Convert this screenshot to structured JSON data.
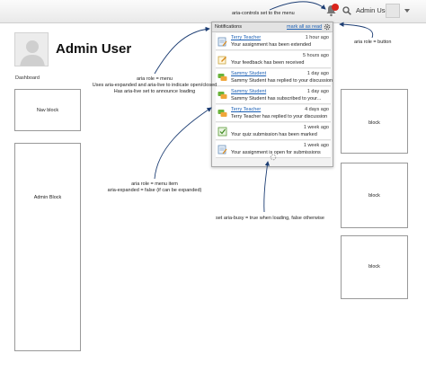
{
  "topbar": {
    "username": "Admin User"
  },
  "page": {
    "title": "Admin User",
    "breadcrumb": "Dashboard"
  },
  "blocks": {
    "nav": "Nav block",
    "admin": "Admin Block",
    "right1": "block",
    "right2": "block",
    "right3": "block"
  },
  "notifications": {
    "header": "Notifications",
    "mark_all": "mark all as read",
    "items": [
      {
        "name": "Terry Teacher",
        "time": "1 hour ago",
        "text": "Your assignment has been extended",
        "icon": "assignment-icon"
      },
      {
        "name": "",
        "time": "5 hours ago",
        "text": "Your feedback has been received",
        "icon": "feedback-icon"
      },
      {
        "name": "Sammy Student",
        "time": "1 day ago",
        "text": "Sammy Student has replied to your discussion",
        "icon": "forum-icon"
      },
      {
        "name": "Sammy Student",
        "time": "1 day ago",
        "text": "Sammy Student has subscribed to your...",
        "icon": "forum-icon"
      },
      {
        "name": "Terry Teacher",
        "time": "4 days ago",
        "text": "Terry Teacher has replied to your discussion",
        "icon": "forum-icon"
      },
      {
        "name": "",
        "time": "1 week ago",
        "text": "Your quiz submission has been marked",
        "icon": "quiz-icon"
      },
      {
        "name": "",
        "time": "1 week ago",
        "text": "Your assignment is open for submissions",
        "icon": "assignment-icon"
      }
    ]
  },
  "annotations": {
    "controls": "aria-controls set to the menu",
    "button": "aria role = button",
    "menu_1": "aria role = menu",
    "menu_2": "Uses aria-expanded and aria-live to indicate open/closed",
    "menu_3": "Has aria-live set to announce loading",
    "item_1": "aria role = menu item",
    "item_2": "aria-expanded = false (if can be expanded)",
    "busy": "set aria-busy = true when loading, false otherwise"
  },
  "colors": {
    "link": "#1a5fb4",
    "badge": "#d9241b",
    "arrow": "#1c3d73"
  }
}
